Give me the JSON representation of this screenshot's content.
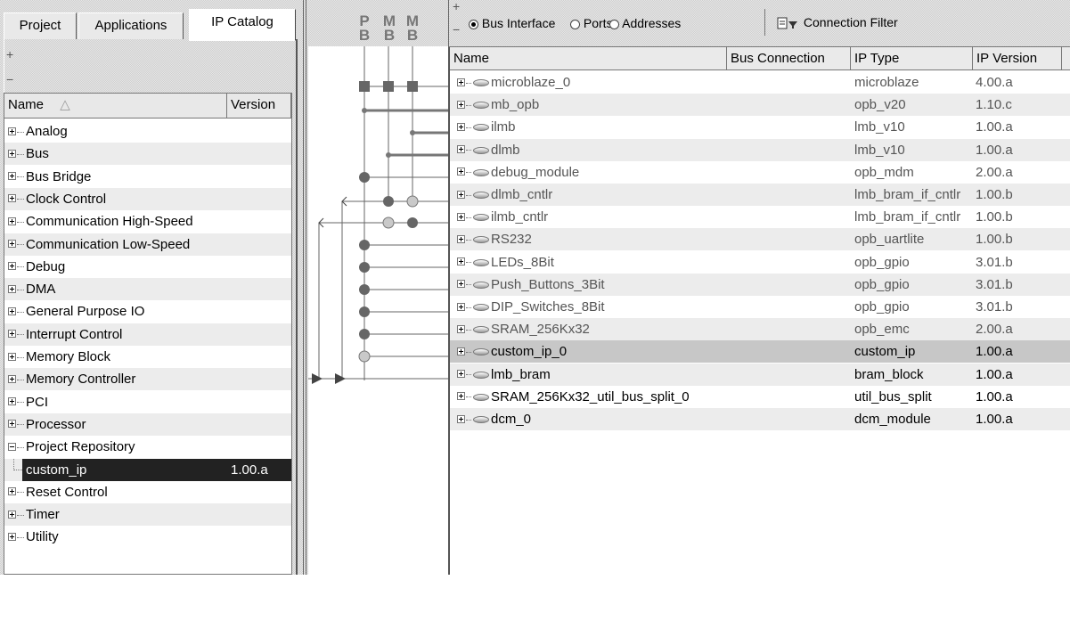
{
  "left_panel": {
    "tabs": [
      "Project",
      "Applications",
      "IP Catalog"
    ],
    "active_tab": "IP Catalog",
    "expand_all": "+",
    "collapse_all": "−",
    "table_headers": {
      "name": "Name",
      "sort_indicator": "△",
      "version": "Version"
    },
    "catalog": [
      {
        "label": "Analog",
        "toggle": "+"
      },
      {
        "label": "Bus",
        "toggle": "+"
      },
      {
        "label": "Bus Bridge",
        "toggle": "+"
      },
      {
        "label": "Clock Control",
        "toggle": "+"
      },
      {
        "label": "Communication High-Speed",
        "toggle": "+"
      },
      {
        "label": "Communication Low-Speed",
        "toggle": "+"
      },
      {
        "label": "Debug",
        "toggle": "+"
      },
      {
        "label": "DMA",
        "toggle": "+"
      },
      {
        "label": "General Purpose IO",
        "toggle": "+"
      },
      {
        "label": "Interrupt Control",
        "toggle": "+"
      },
      {
        "label": "Memory Block",
        "toggle": "+"
      },
      {
        "label": "Memory Controller",
        "toggle": "+"
      },
      {
        "label": "PCI",
        "toggle": "+"
      },
      {
        "label": "Processor",
        "toggle": "+"
      },
      {
        "label": "Project Repository",
        "toggle": "−"
      },
      {
        "label": "custom_ip",
        "version": "1.00.a",
        "child": true,
        "selected": true
      },
      {
        "label": "Reset Control",
        "toggle": "+"
      },
      {
        "label": "Timer",
        "toggle": "+"
      },
      {
        "label": "Utility",
        "toggle": "+"
      }
    ]
  },
  "bus_diagram": {
    "buses": [
      {
        "top": "P",
        "bottom": "B"
      },
      {
        "top": "M",
        "bottom": "B"
      },
      {
        "top": "M",
        "bottom": "B"
      }
    ]
  },
  "right_panel": {
    "filter_options": [
      {
        "label": "Bus Interface",
        "selected": true
      },
      {
        "label": "Ports",
        "selected": false
      },
      {
        "label": "Addresses",
        "selected": false
      }
    ],
    "expand_all": "+",
    "collapse_all": "−",
    "connection_filter_label": "Connection Filter",
    "table_headers": {
      "name": "Name",
      "bus_connection": "Bus Connection",
      "ip_type": "IP Type",
      "ip_version": "IP Version"
    },
    "instances": [
      {
        "name": "microblaze_0",
        "ip_type": "microblaze",
        "ip_version": "4.00.a",
        "dim": true
      },
      {
        "name": "mb_opb",
        "ip_type": "opb_v20",
        "ip_version": "1.10.c",
        "dim": true
      },
      {
        "name": "ilmb",
        "ip_type": "lmb_v10",
        "ip_version": "1.00.a",
        "dim": true
      },
      {
        "name": "dlmb",
        "ip_type": "lmb_v10",
        "ip_version": "1.00.a",
        "dim": true
      },
      {
        "name": "debug_module",
        "ip_type": "opb_mdm",
        "ip_version": "2.00.a",
        "dim": true
      },
      {
        "name": "dlmb_cntlr",
        "ip_type": "lmb_bram_if_cntlr",
        "ip_version": "1.00.b",
        "dim": true
      },
      {
        "name": "ilmb_cntlr",
        "ip_type": "lmb_bram_if_cntlr",
        "ip_version": "1.00.b",
        "dim": true
      },
      {
        "name": "RS232",
        "ip_type": "opb_uartlite",
        "ip_version": "1.00.b",
        "dim": true
      },
      {
        "name": "LEDs_8Bit",
        "ip_type": "opb_gpio",
        "ip_version": "3.01.b",
        "dim": true
      },
      {
        "name": "Push_Buttons_3Bit",
        "ip_type": "opb_gpio",
        "ip_version": "3.01.b",
        "dim": true
      },
      {
        "name": "DIP_Switches_8Bit",
        "ip_type": "opb_gpio",
        "ip_version": "3.01.b",
        "dim": true
      },
      {
        "name": "SRAM_256Kx32",
        "ip_type": "opb_emc",
        "ip_version": "2.00.a",
        "dim": true
      },
      {
        "name": "custom_ip_0",
        "ip_type": "custom_ip",
        "ip_version": "1.00.a",
        "highlighted": true
      },
      {
        "name": "lmb_bram",
        "ip_type": "bram_block",
        "ip_version": "1.00.a"
      },
      {
        "name": "SRAM_256Kx32_util_bus_split_0",
        "ip_type": "util_bus_split",
        "ip_version": "1.00.a"
      },
      {
        "name": "dcm_0",
        "ip_type": "dcm_module",
        "ip_version": "1.00.a"
      }
    ]
  }
}
